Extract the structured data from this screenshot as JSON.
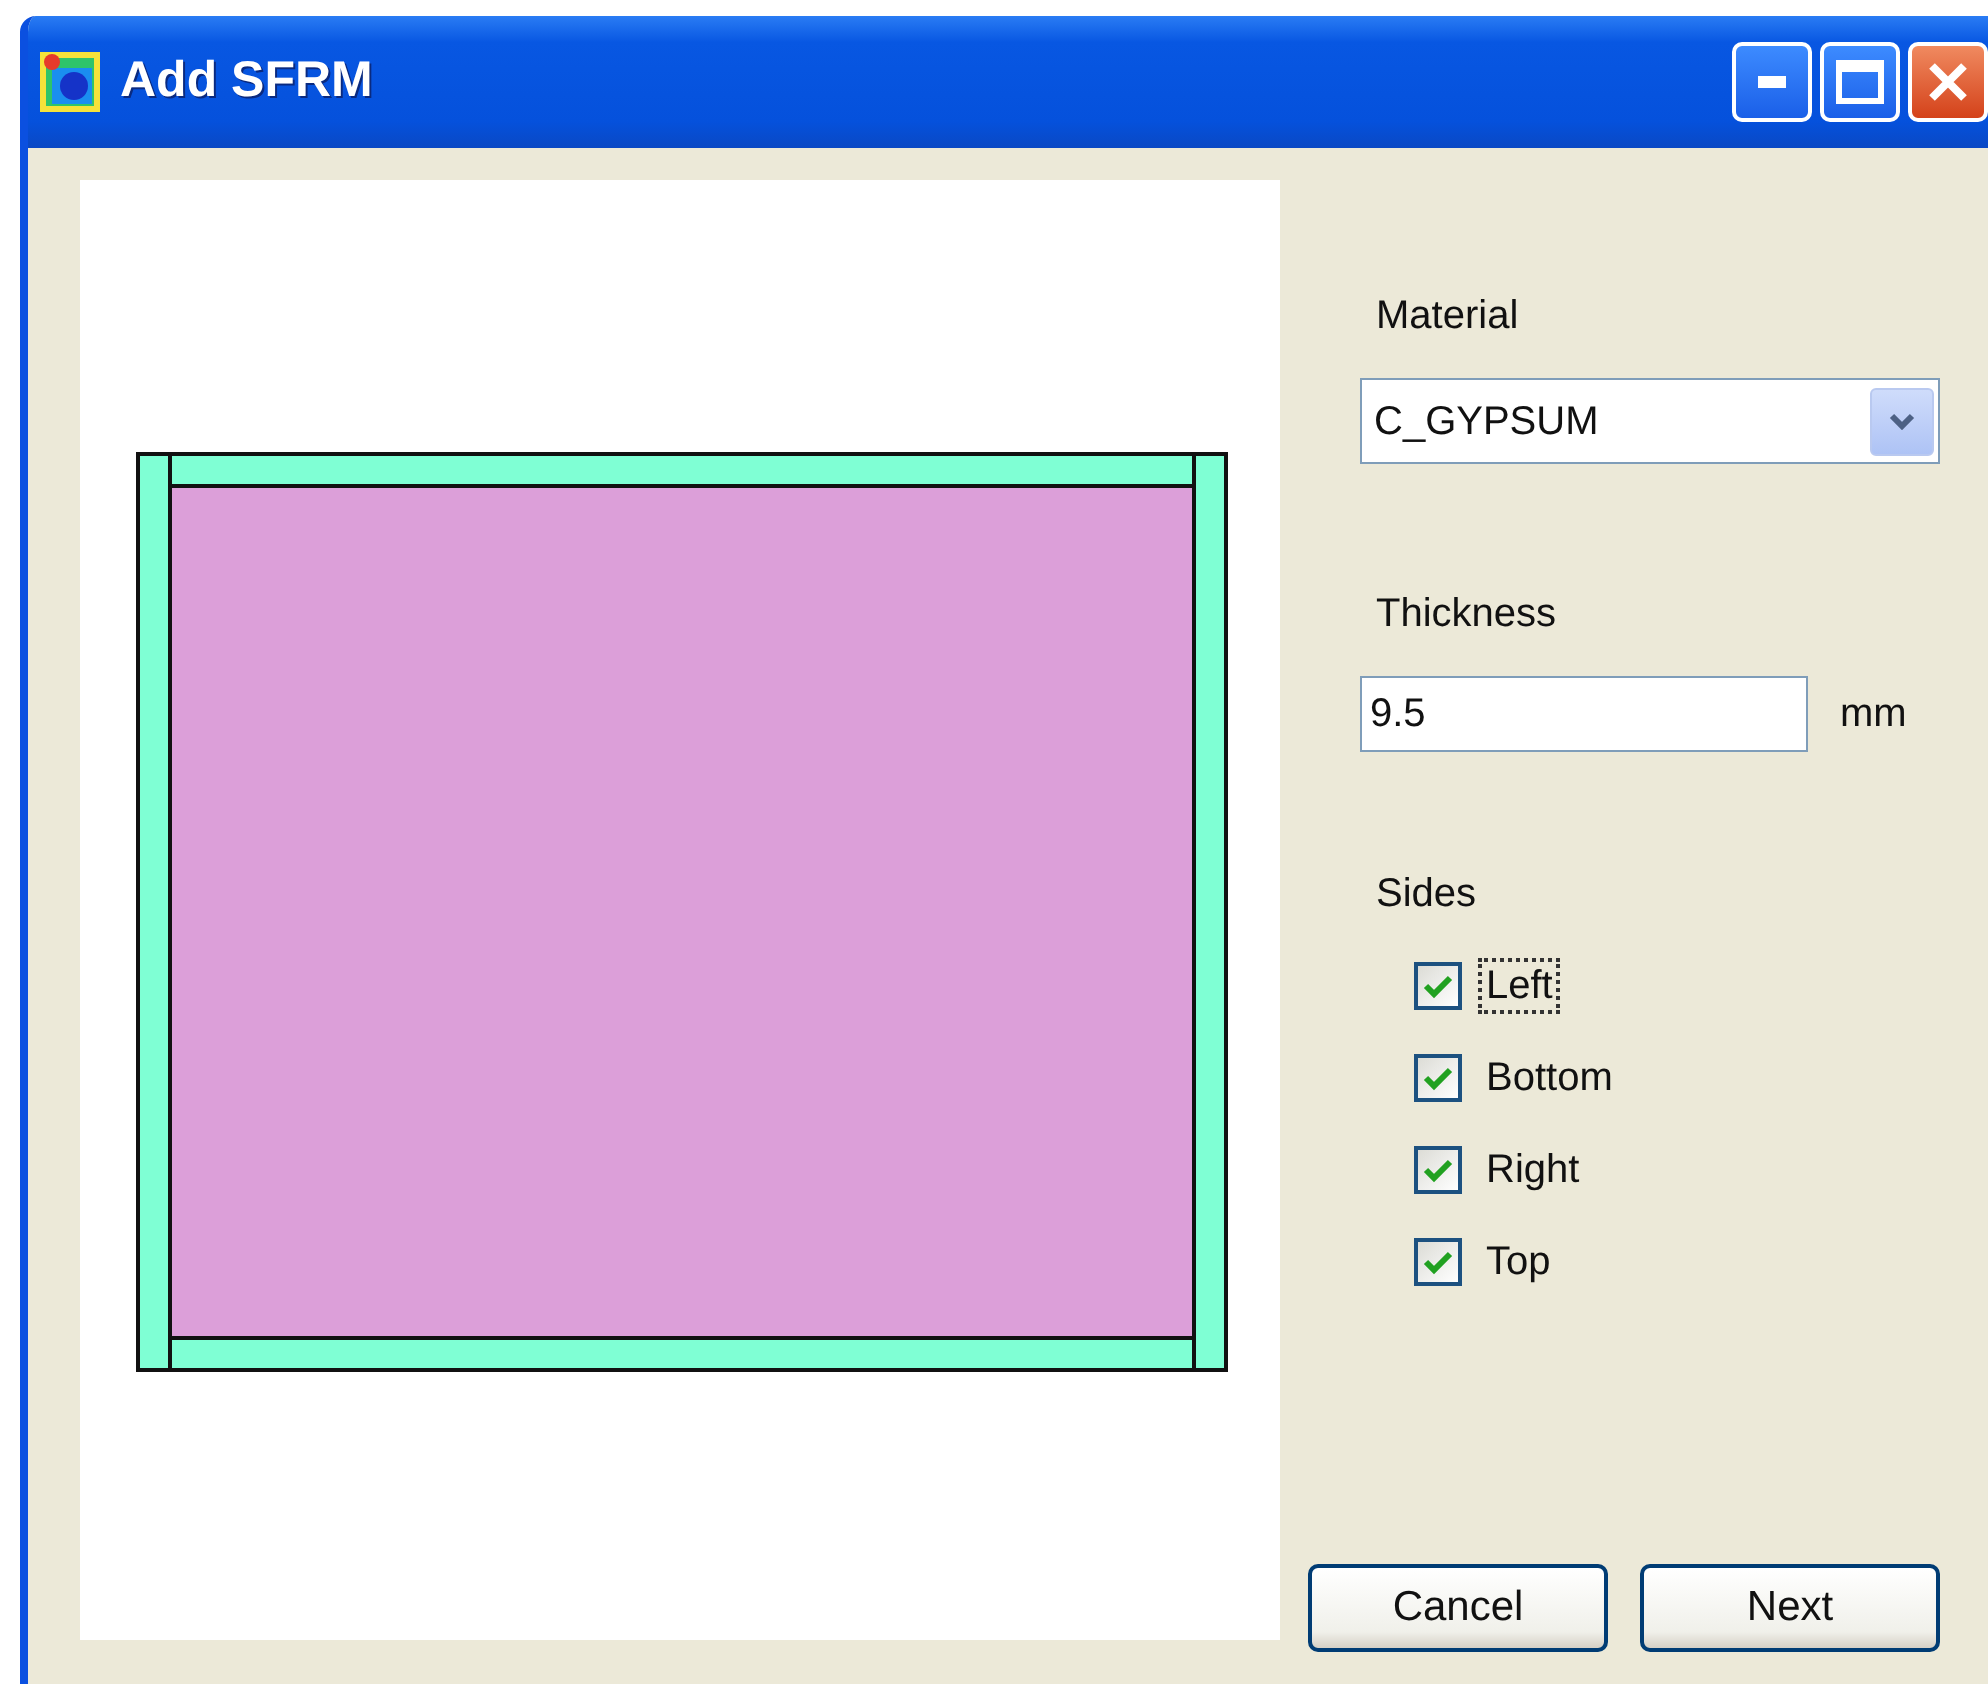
{
  "window": {
    "title": "Add SFRM"
  },
  "material": {
    "label": "Material",
    "value": "C_GYPSUM"
  },
  "thickness": {
    "label": "Thickness",
    "value": "9.5",
    "unit": "mm"
  },
  "sides": {
    "label": "Sides",
    "items": [
      {
        "label": "Left",
        "checked": true,
        "focused": true
      },
      {
        "label": "Bottom",
        "checked": true,
        "focused": false
      },
      {
        "label": "Right",
        "checked": true,
        "focused": false
      },
      {
        "label": "Top",
        "checked": true,
        "focused": false
      }
    ]
  },
  "buttons": [
    "Cancel",
    "Next"
  ]
}
